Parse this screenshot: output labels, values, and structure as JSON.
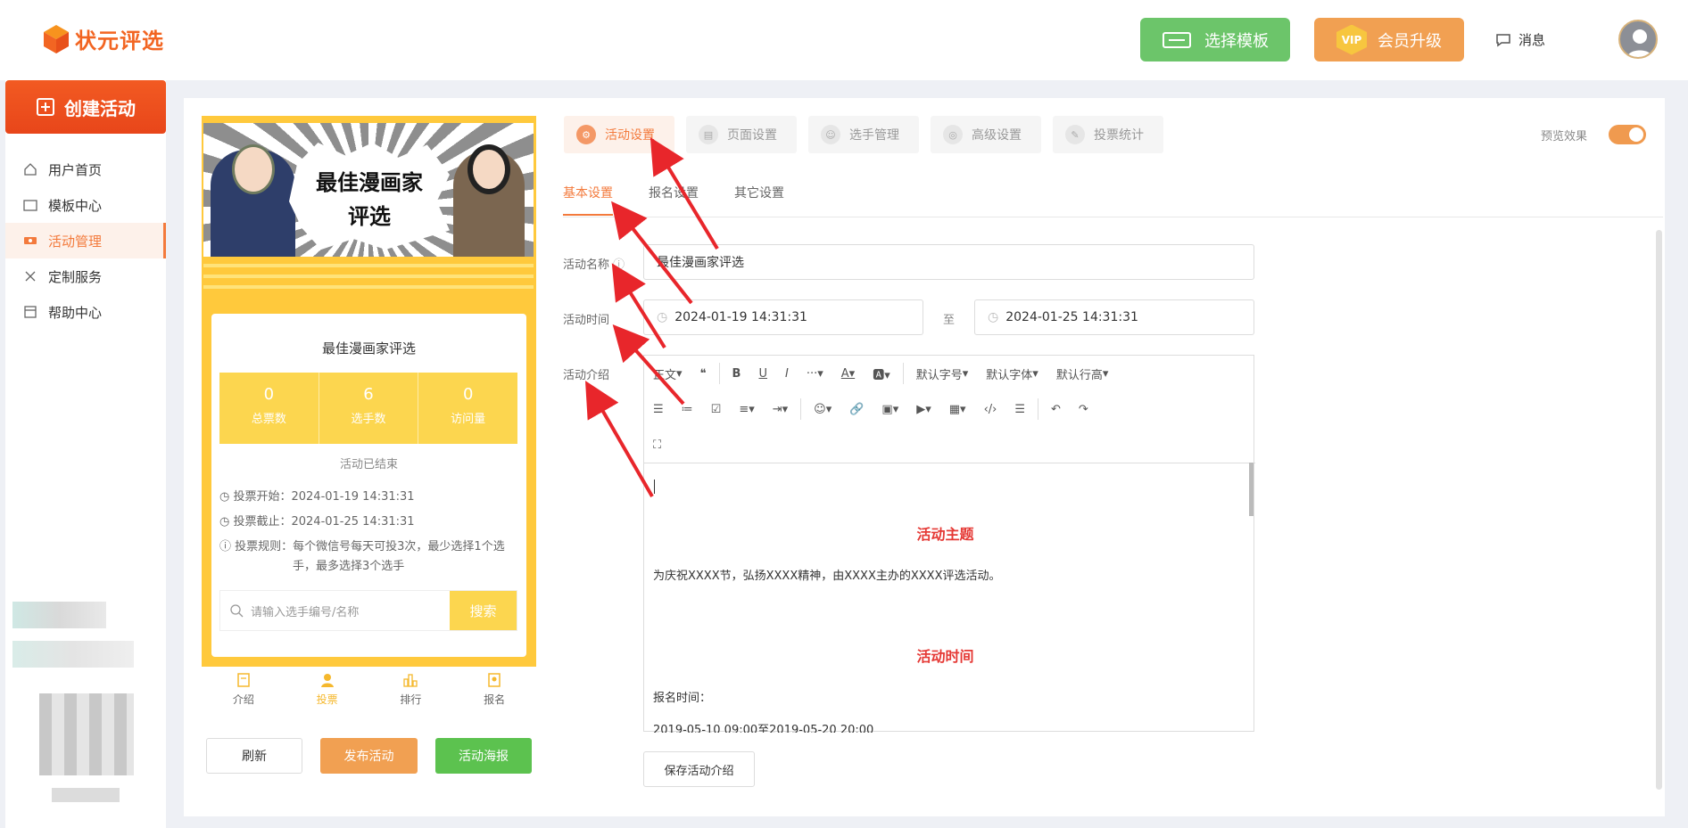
{
  "header": {
    "logo_text": "状元评选",
    "template_button": "选择模板",
    "vip_badge": "VIP",
    "vip_button": "会员升级",
    "messages": "消息"
  },
  "sidebar": {
    "create_button": "创建活动",
    "items": [
      {
        "label": "用户首页",
        "icon": "home-icon"
      },
      {
        "label": "模板中心",
        "icon": "folder-icon"
      },
      {
        "label": "活动管理",
        "icon": "ticket-icon",
        "active": true
      },
      {
        "label": "定制服务",
        "icon": "tools-icon"
      },
      {
        "label": "帮助中心",
        "icon": "book-icon"
      }
    ]
  },
  "preview": {
    "banner_title_line1": "最佳漫画家",
    "banner_title_line2": "评选",
    "card_title": "最佳漫画家评选",
    "stats": [
      {
        "value": "0",
        "label": "总票数"
      },
      {
        "value": "6",
        "label": "选手数"
      },
      {
        "value": "0",
        "label": "访问量"
      }
    ],
    "status": "活动已结束",
    "vote_start": "投票开始：2024-01-19 14:31:31",
    "vote_end": "投票截止：2024-01-25 14:31:31",
    "vote_rule_1": "投票规则：每个微信号每天可投3次，最少选择1个选",
    "vote_rule_2": "手，最多选择3个选手",
    "search_placeholder": "请输入选手编号/名称",
    "search_button": "搜索",
    "tabs": [
      "介绍",
      "投票",
      "排行",
      "报名"
    ]
  },
  "actions": {
    "refresh": "刷新",
    "publish": "发布活动",
    "poster": "活动海报"
  },
  "settings": {
    "top_tabs": [
      "活动设置",
      "页面设置",
      "选手管理",
      "高级设置",
      "投票统计"
    ],
    "preview_label": "预览效果",
    "sub_tabs": [
      "基本设置",
      "报名设置",
      "其它设置"
    ],
    "name_label": "活动名称",
    "name_value": "最佳漫画家评选",
    "time_label": "活动时间",
    "start_time": "2024-01-19 14:31:31",
    "time_separator": "至",
    "end_time": "2024-01-25 14:31:31",
    "intro_label": "活动介绍",
    "save_button": "保存活动介绍"
  },
  "editor": {
    "paragraph_style": "正文",
    "font_size": "默认字号",
    "font_family": "默认字体",
    "line_height": "默认行高",
    "heading1": "活动主题",
    "body1": "为庆祝XXXX节，弘扬XXXX精神，由XXXX主办的XXXX评选活动。",
    "heading2": "活动时间",
    "body2": "报名时间：",
    "body3": "2019-05-10 09:00至2019-05-20 20:00"
  },
  "colors": {
    "brand_orange": "#f37a3c",
    "template_green": "#6cc56a",
    "vip_orange": "#f1a052",
    "preview_yellow": "#ffc93c",
    "heading_red": "#e53935"
  }
}
